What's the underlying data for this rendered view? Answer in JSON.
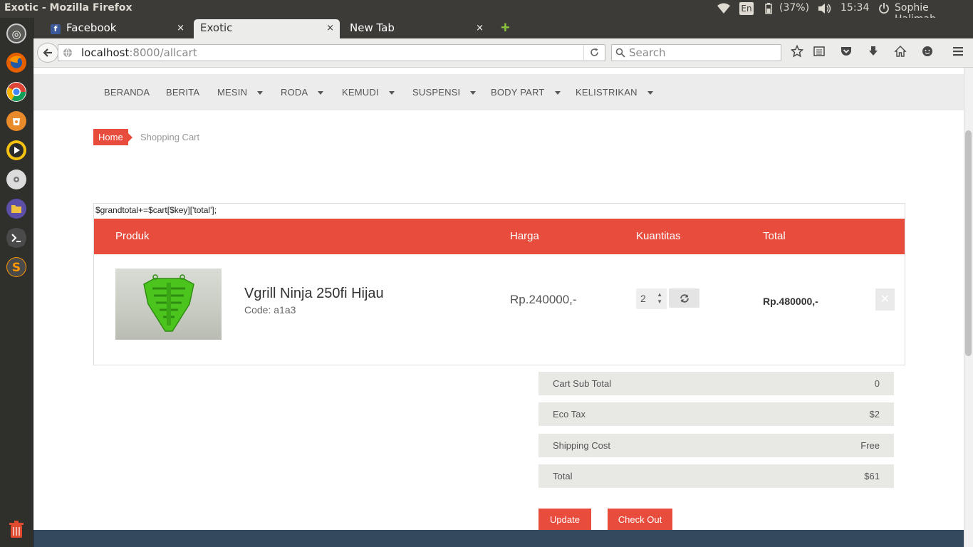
{
  "os_panel": {
    "window_title": "Exotic - Mozilla Firefox",
    "keyboard_layout": "En",
    "battery": "(37%)",
    "clock": "15:34",
    "user": "Sophie Halimah"
  },
  "launcher": {
    "items": [
      "dash-home",
      "firefox",
      "chrome",
      "software-center",
      "media-player",
      "disk",
      "files",
      "terminal",
      "sublime-text",
      "trash"
    ]
  },
  "browser": {
    "tabs": [
      {
        "label": "Facebook",
        "close": "×"
      },
      {
        "label": "Exotic",
        "close": "×"
      },
      {
        "label": "New Tab",
        "close": "×"
      }
    ],
    "new_tab": "+",
    "url_host": "localhost",
    "url_path": ":8000/allcart",
    "search_placeholder": "Search"
  },
  "site": {
    "menu": [
      {
        "label": "BERANDA"
      },
      {
        "label": "BERITA"
      },
      {
        "label": "MESIN"
      },
      {
        "label": "RODA"
      },
      {
        "label": "KEMUDI"
      },
      {
        "label": "SUSPENSI"
      },
      {
        "label": "BODY PART"
      },
      {
        "label": "KELISTRIKAN"
      }
    ],
    "breadcrumb": {
      "home": "Home",
      "current": "Shopping Cart"
    },
    "debug_text": "$grandtotal+=$cart[$key]['total'];",
    "cart": {
      "headers": {
        "product": "Produk",
        "price": "Harga",
        "qty": "Kuantitas",
        "total": "Total"
      },
      "items": [
        {
          "name": "Vgrill Ninja 250fi Hijau",
          "code": "Code: a1a3",
          "price": "Rp.240000,-",
          "qty": "2",
          "total": "Rp.480000,-"
        }
      ]
    },
    "summary": [
      {
        "label": "Cart Sub Total",
        "value": "0"
      },
      {
        "label": "Eco Tax",
        "value": "$2"
      },
      {
        "label": "Shipping Cost",
        "value": "Free"
      },
      {
        "label": "Total",
        "value": "$61"
      }
    ],
    "buttons": {
      "update": "Update",
      "checkout": "Check Out"
    }
  },
  "colors": {
    "accent": "#e74c3c",
    "nav_bg": "#ececec",
    "footer": "#34495e"
  }
}
